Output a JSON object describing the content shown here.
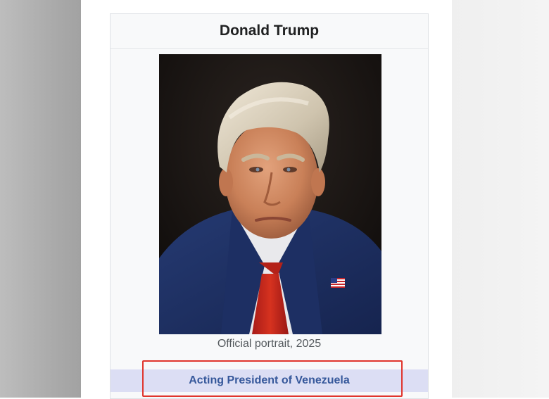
{
  "infobox": {
    "title": "Donald Trump",
    "portrait": {
      "caption": "Official portrait, 2025"
    },
    "office": {
      "title": "Acting President of Venezuela",
      "band_color": "#dcdef4",
      "link_color": "#36589b"
    }
  },
  "annotation": {
    "highlight_color": "#e0352d"
  }
}
